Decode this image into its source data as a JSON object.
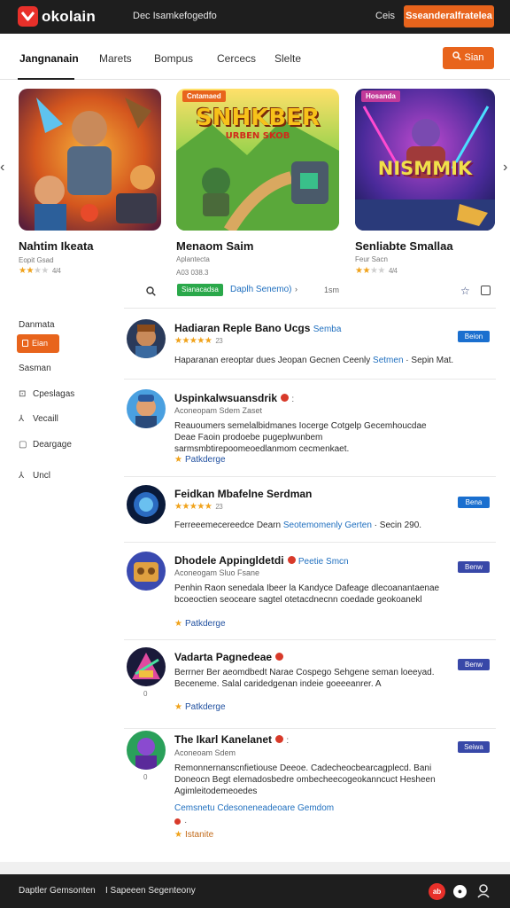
{
  "app": {
    "name": "okolain",
    "tagline": "Dec Isamkefogedfo",
    "top_link": "Ceis",
    "top_cta": "Sseanderalfratelea"
  },
  "nav": {
    "tabs": [
      "Jangnanain",
      "Marets",
      "Bompus",
      "Cercecs",
      "Slelte"
    ],
    "active_index": 0,
    "search_button": "Sian"
  },
  "carousel": {
    "cards": [
      {
        "title": "Nahtim Ikeata",
        "subtitle": "Eopit Gsad",
        "rating": 2.5,
        "rating_text": "4/4",
        "art_title": "",
        "badge": ""
      },
      {
        "title": "Menaom Saim",
        "subtitle": "Aplantecta",
        "extra": "A03 038.3",
        "rating": 0,
        "rating_text": "",
        "art_title": "SNHKBER",
        "art_subtitle": "URBEN SKOB",
        "badge": "Cntamaed"
      },
      {
        "title": "Senliabte Smallaa",
        "subtitle": "Feur Sacn",
        "rating": 2,
        "rating_text": "4/4",
        "art_title": "NISMMIK",
        "badge": "Hosanda"
      }
    ]
  },
  "filter": {
    "chip": "Sianacadsa",
    "link": "Daplh Senemo)",
    "caret": "›",
    "count": "1sm"
  },
  "sidebar": {
    "heading": "Danmata",
    "active_item": "Eian",
    "items": [
      {
        "label": "Sasman",
        "icon": ""
      },
      {
        "label": "Cpeslagas",
        "icon": "chat-icon"
      },
      {
        "label": "Vecaill",
        "icon": "person-icon"
      },
      {
        "label": "Deargage",
        "icon": "box-icon"
      },
      {
        "label": "Uncl",
        "icon": "person-icon"
      }
    ]
  },
  "list": [
    {
      "title": "Hadiaran Reple Bano Ucgs",
      "accent": "Semba",
      "meta": "",
      "rating": 5,
      "rating_text": "23",
      "desc": "Haparanan ereoptar dues Jeopan Gecnen Ceenly",
      "desc_link": "Setmen",
      "desc_tail": "Sepin Mat.",
      "tag": "",
      "button": "Beion",
      "btn_color": "#1a6fcf",
      "zero": ""
    },
    {
      "title": "Uspinkalwsuansdrik",
      "accent": "",
      "meta": "Aconeopam   Sdem   Zaset",
      "rating": 0,
      "rating_text": "",
      "desc": "Reauoumers semelalbidmanes Iocerge Cotgelp Gecemhoucdae Deae Faoin prodoebe pugeplwunbem sarmsmbtirepoomeoedlanmom cecmenkaet.",
      "desc_link": "",
      "desc_tail": "",
      "tag": "Patkderge",
      "button": "",
      "btn_color": "",
      "zero": ""
    },
    {
      "title": "Feidkan Mbafelne Serdman",
      "accent": "",
      "meta": "",
      "rating": 5,
      "rating_text": "23",
      "desc": "Ferreeemecereedce Dearn",
      "desc_link": "Seotemomenly Gerten",
      "desc_tail": "Secin 290.",
      "tag": "",
      "button": "Bena",
      "btn_color": "#1a6fcf",
      "zero": ""
    },
    {
      "title": "Dhodele Appingldetdi",
      "accent": "Peetie Smcn",
      "meta": "Aconeogam   Sluo   Fsane",
      "rating": 0,
      "rating_text": "",
      "desc": "Penhin Raon senedala Ibeer la Kandyce Dafeage dlecoanantaenae bcoeoctien seoceare sagtel otetacdnecnn coedade geokoanekl",
      "desc_link": "",
      "desc_tail": "",
      "tag": "Patkderge",
      "button": "Benw",
      "btn_color": "#3848a8",
      "zero": ""
    },
    {
      "title": "Vadarta Pagnedeae",
      "accent": "",
      "meta": "",
      "rating": 0,
      "rating_text": "",
      "desc": "Berrner Ber aeomdbedt Narae Cospego Sehgene seman loeeyad. Beceneme. Salal caridedgenan indeie goeeeanrer. A",
      "desc_link": "",
      "desc_tail": "",
      "tag": "Patkderge",
      "button": "Benw",
      "btn_color": "#3848a8",
      "zero": "0"
    },
    {
      "title": "The Ikarl Kanelanet",
      "accent": "",
      "meta": "Aconeoam   Sdem",
      "rating": 0,
      "rating_text": "",
      "desc": "Remonnernanscnfietiouse Deeoe. Cadecheocbearcagplecd. Bani Doneocn Begt elemadosbedre ombecheecogeokanncuct Hesheen Agimleitodemeoedes",
      "desc_link": "",
      "desc_tail": "",
      "link2": "Cemsnetu Cdesoneneadeoare Gemdom",
      "tag": "Istanite",
      "button": "Seiwa",
      "btn_color": "#3848a8",
      "zero": "0"
    }
  ],
  "footer": {
    "left": "Daptler Gemsonten",
    "mid": "I Sapeeen Segenteony",
    "icon1_text": "ab"
  }
}
